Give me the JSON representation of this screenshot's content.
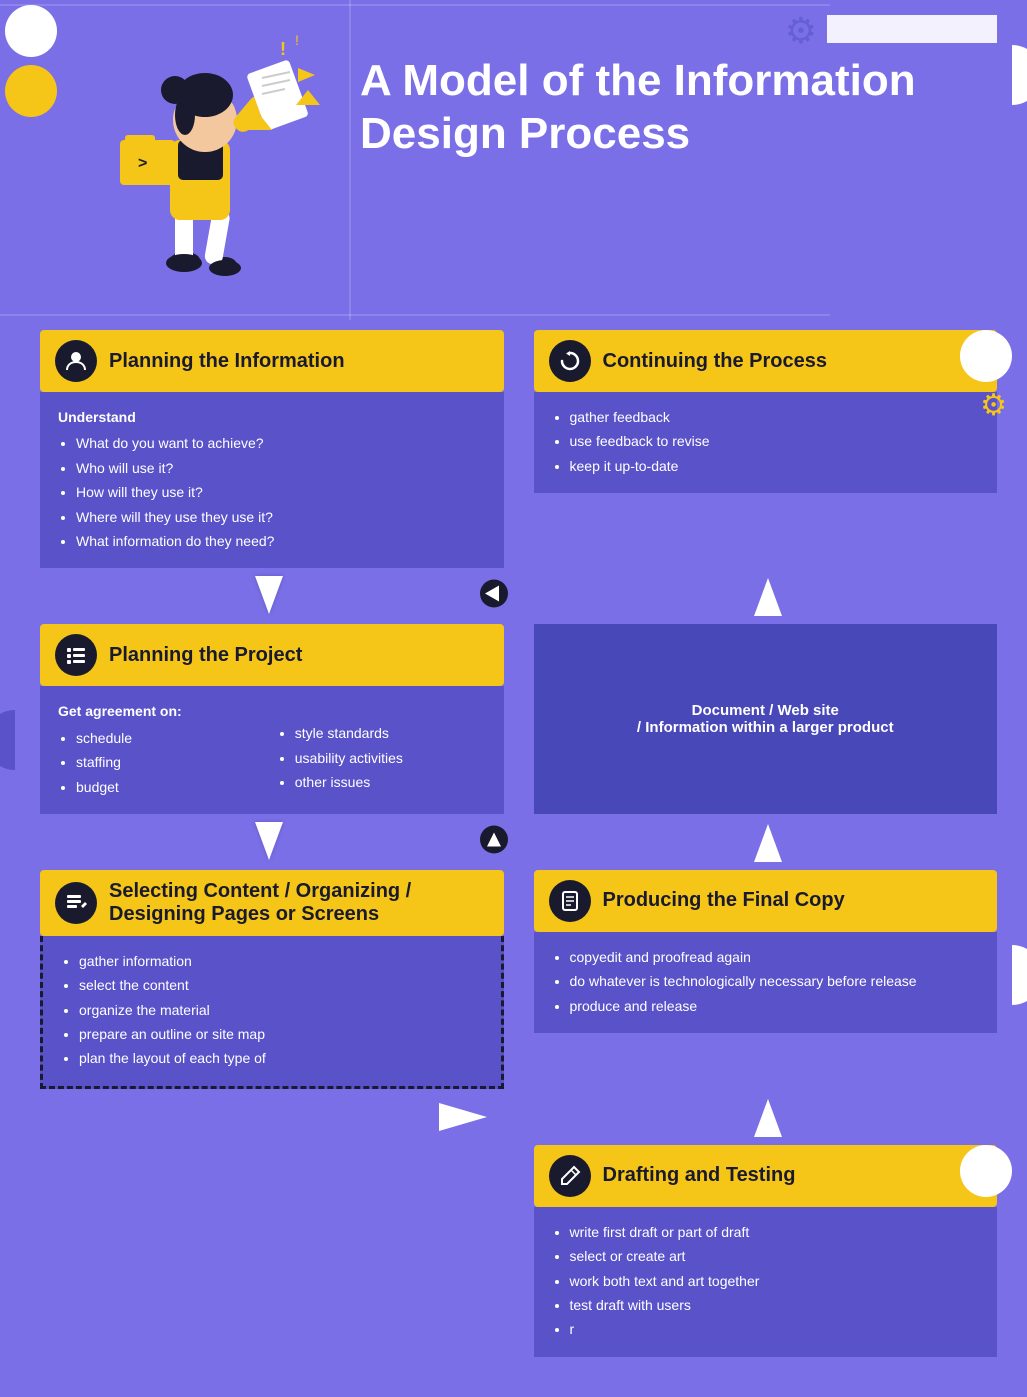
{
  "hero": {
    "title": "A Model of the Information Design Process"
  },
  "sections": {
    "planning_info": {
      "title": "Planning the Information",
      "icon": "person",
      "understand_label": "Understand",
      "bullets": [
        "What do you want to achieve?",
        "Who will use it?",
        "How will they use it?",
        "Where will they use they use it?",
        "What information do they need?"
      ]
    },
    "continuing": {
      "title": "Continuing the Process",
      "icon": "refresh",
      "bullets": [
        "gather feedback",
        "use feedback to revise",
        "keep it up-to-date"
      ]
    },
    "planning_project": {
      "title": "Planning the Project",
      "icon": "list",
      "get_agreement": "Get agreement on:",
      "col1_bullets": [
        "schedule",
        "staffing",
        "budget"
      ],
      "col2_bullets": [
        "style standards",
        "usability activities",
        "other issues"
      ]
    },
    "document_box": {
      "line1": "Document  /  Web site",
      "line2": "/  Information within a larger product"
    },
    "selecting": {
      "title": "Selecting Content / Organizing / Designing Pages or Screens",
      "icon": "edit-list",
      "bullets": [
        "gather information",
        "select the content",
        "organize the material",
        "prepare an outline or site map",
        "plan the layout of each type of"
      ]
    },
    "producing": {
      "title": "Producing the Final Copy",
      "icon": "document",
      "bullets": [
        "copyedit and proofread again",
        "do whatever is technologically necessary before release",
        "produce and release"
      ]
    },
    "drafting": {
      "title": "Drafting and Testing",
      "icon": "pencil",
      "bullets": [
        "write first draft or part of draft",
        "select or create art",
        "work both text and art together",
        "test draft with users",
        "r"
      ]
    }
  },
  "arrows": {
    "down": "↓",
    "up": "↑",
    "right": "→"
  }
}
